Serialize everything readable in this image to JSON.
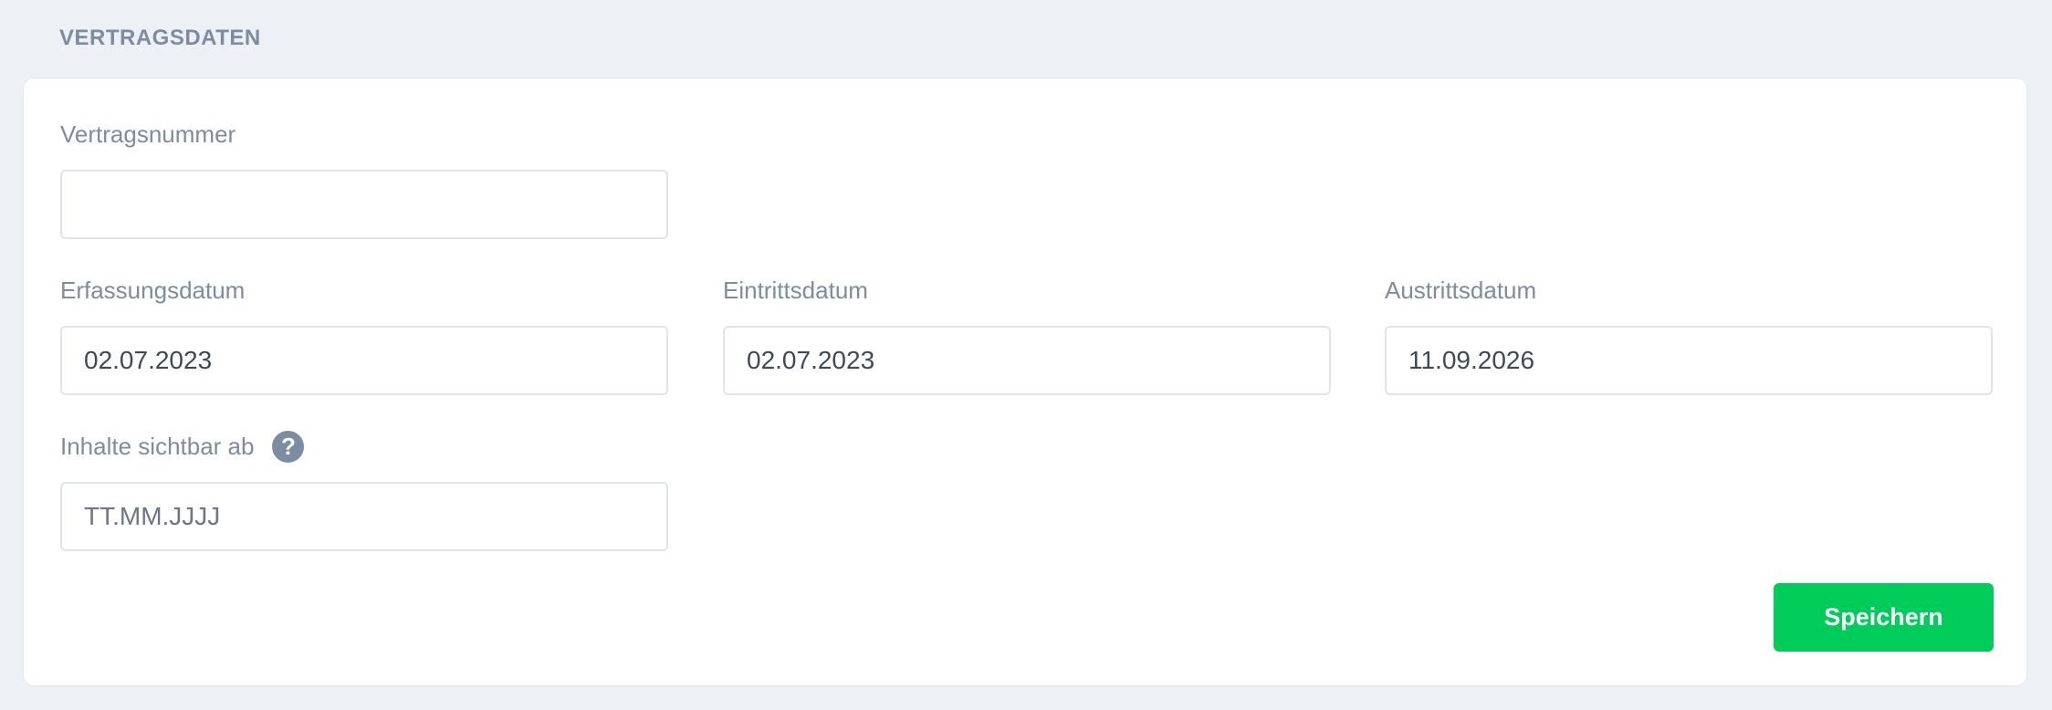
{
  "section": {
    "title": "VERTRAGSDATEN"
  },
  "form": {
    "vertragsnummer": {
      "label": "Vertragsnummer",
      "value": "",
      "placeholder": ""
    },
    "erfassungsdatum": {
      "label": "Erfassungsdatum",
      "value": "02.07.2023"
    },
    "eintrittsdatum": {
      "label": "Eintrittsdatum",
      "value": "02.07.2023"
    },
    "austrittsdatum": {
      "label": "Austrittsdatum",
      "value": "11.09.2026"
    },
    "inhalte_sichtbar_ab": {
      "label": "Inhalte sichtbar ab",
      "value": "",
      "placeholder": "TT.MM.JJJJ",
      "help_icon": "question-circle-icon",
      "help_glyph": "?"
    },
    "save_label": "Speichern"
  },
  "colors": {
    "page_background": "#edf0f5",
    "card_background": "#ffffff",
    "label_text": "#7c8ca3",
    "input_border": "#dfe4ea",
    "accent_green": "#00cc5a"
  }
}
